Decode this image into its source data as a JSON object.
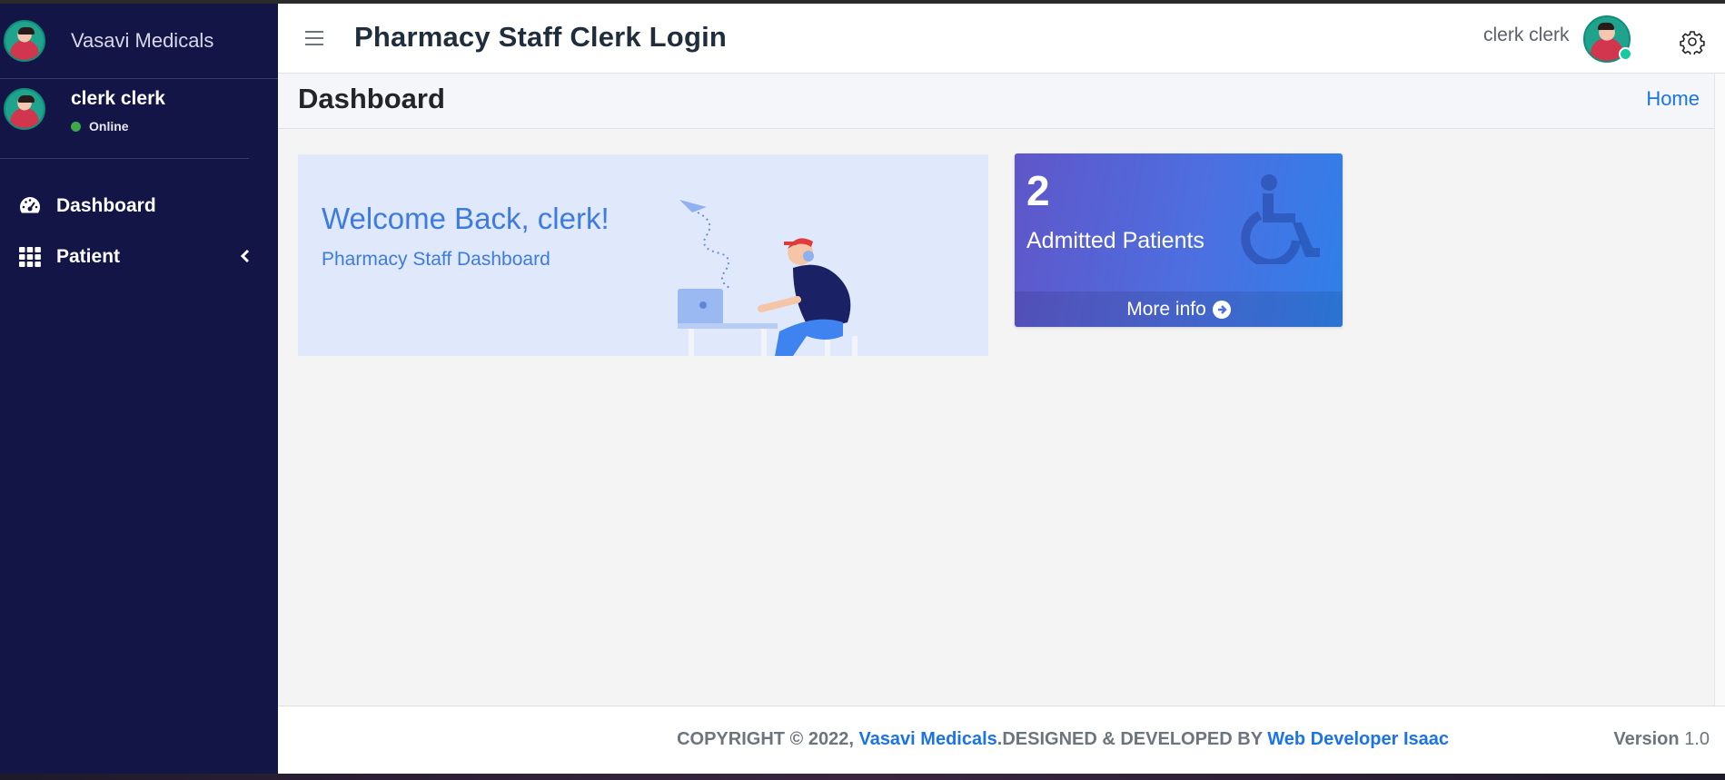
{
  "sidebar": {
    "brand": "Vasavi Medicals",
    "user": {
      "name": "clerk clerk",
      "status": "Online"
    },
    "items": [
      {
        "label": "Dashboard",
        "icon": "dashboard-gauge-icon"
      },
      {
        "label": "Patient",
        "icon": "grid-icon",
        "has_submenu": true
      }
    ]
  },
  "header": {
    "title": "Pharmacy Staff Clerk Login",
    "user_name": "clerk clerk"
  },
  "content_header": {
    "title": "Dashboard",
    "breadcrumb": "Home"
  },
  "welcome": {
    "title": "Welcome Back, clerk!",
    "subtitle": "Pharmacy Staff Dashboard"
  },
  "stat_box": {
    "value": "2",
    "label": "Admitted Patients",
    "footer": "More info",
    "icon": "wheelchair-icon"
  },
  "footer": {
    "copyright": "COPYRIGHT © 2022, ",
    "brand_link": "Vasavi Medicals",
    "designed": ".DESIGNED & DEVELOPED BY ",
    "dev_link": "Web Developer Isaac",
    "version_label": "Version",
    "version": "1.0"
  },
  "colors": {
    "sidebar_bg": "#121546",
    "accent": "#1a73e8",
    "online": "#3ea84a"
  }
}
